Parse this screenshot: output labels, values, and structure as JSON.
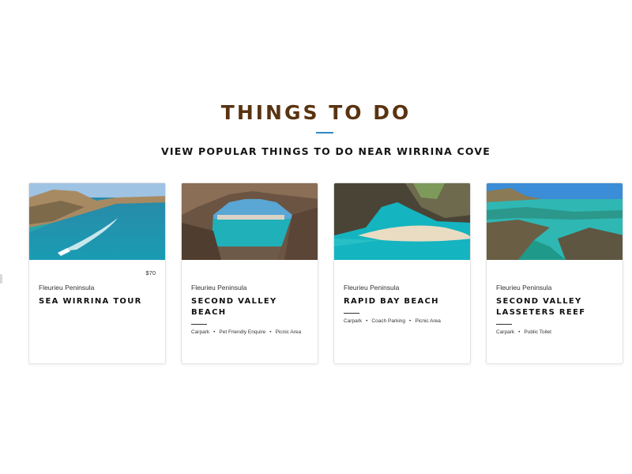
{
  "section": {
    "title": "THINGS TO DO",
    "subtitle": "VIEW POPULAR THINGS TO DO NEAR WIRRINA COVE",
    "accent_color": "#2f88c4",
    "title_color": "#5a3310"
  },
  "cards": [
    {
      "price": "$70",
      "region": "Fleurieu Peninsula",
      "name": "SEA WIRRINA TOUR",
      "features": []
    },
    {
      "price": "",
      "region": "Fleurieu Peninsula",
      "name": "SECOND VALLEY BEACH",
      "features": [
        "Carpark",
        "Pet Friendly Enquire",
        "Picnic Area"
      ]
    },
    {
      "price": "",
      "region": "Fleurieu Peninsula",
      "name": "RAPID BAY BEACH",
      "features": [
        "Carpark",
        "Coach Parking",
        "Picnic Area"
      ]
    },
    {
      "price": "",
      "region": "Fleurieu Peninsula",
      "name": "SECOND VALLEY LASSETERS REEF",
      "features": [
        "Carpark",
        "Public Toilet"
      ]
    }
  ]
}
